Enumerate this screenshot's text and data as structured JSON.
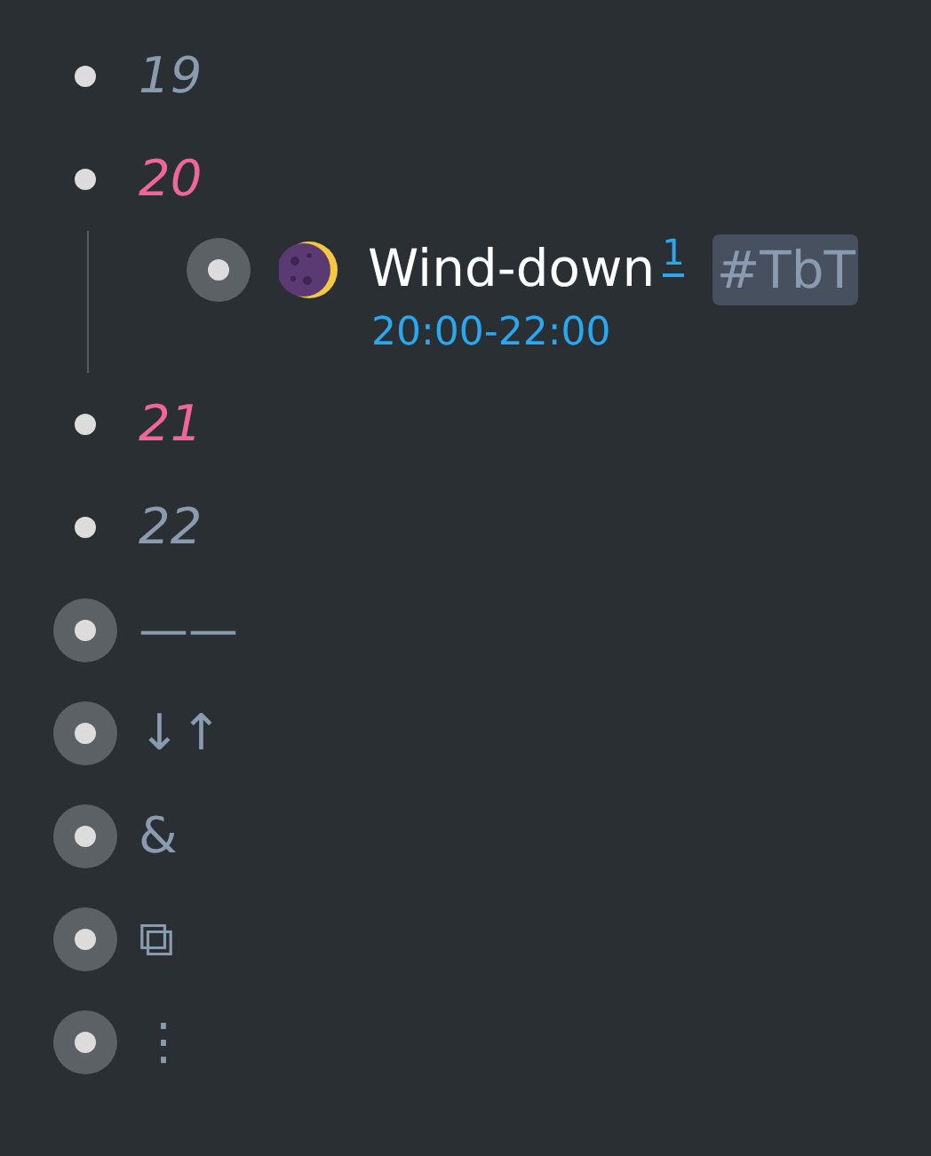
{
  "items": [
    {
      "text": "19",
      "collapsed": false,
      "color": "#8a9bb0",
      "italic": true
    },
    {
      "text": "20",
      "collapsed": false,
      "color": "#f0659a",
      "italic": true,
      "children": [
        {
          "text": "Wind-down",
          "collapsed": true,
          "footnote": "1",
          "tag": "#TbT",
          "note": "20:00-22:00"
        }
      ]
    },
    {
      "text": "21",
      "collapsed": false,
      "color": "#f0659a",
      "italic": true
    },
    {
      "text": "22",
      "collapsed": false,
      "color": "#8a9bb0",
      "italic": true
    },
    {
      "text": "——",
      "collapsed": true,
      "color": "#8a9bb0",
      "italic": false
    },
    {
      "text": "↓↑",
      "collapsed": true,
      "color": "#8a9bb0",
      "italic": false
    },
    {
      "text": "&",
      "collapsed": true,
      "color": "#8a9bb0",
      "italic": false
    },
    {
      "text": "⧉",
      "collapsed": true,
      "color": "#8a9bb0",
      "italic": false
    },
    {
      "text": "⋮",
      "collapsed": true,
      "color": "#8a9bb0",
      "italic": false
    }
  ]
}
